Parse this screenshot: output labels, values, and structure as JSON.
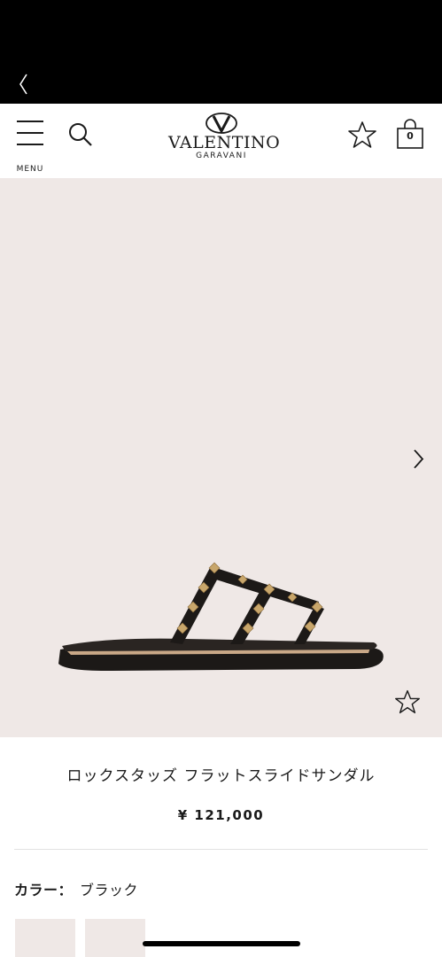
{
  "header": {
    "menu_label": "MENU",
    "logo_name": "VALENTINO",
    "logo_sub": "GARAVANI",
    "bag_count": "0"
  },
  "icons": {
    "back": "chevron-left-icon",
    "menu": "hamburger-icon",
    "search": "search-icon",
    "favorite": "star-icon",
    "bag": "shopping-bag-icon",
    "next": "chevron-right-icon",
    "logo": "valentino-v-logo"
  },
  "product": {
    "title": "ロックスタッズ フラットスライドサンダル",
    "price": "¥ 121,000",
    "color_label": "カラー：",
    "color_value": "ブラック"
  },
  "colors": {
    "gallery_bg": "#efe8e6",
    "shoe_leather": "#1c1917",
    "stud_gold": "#c8a66b",
    "sole_beige": "#c9a887"
  }
}
